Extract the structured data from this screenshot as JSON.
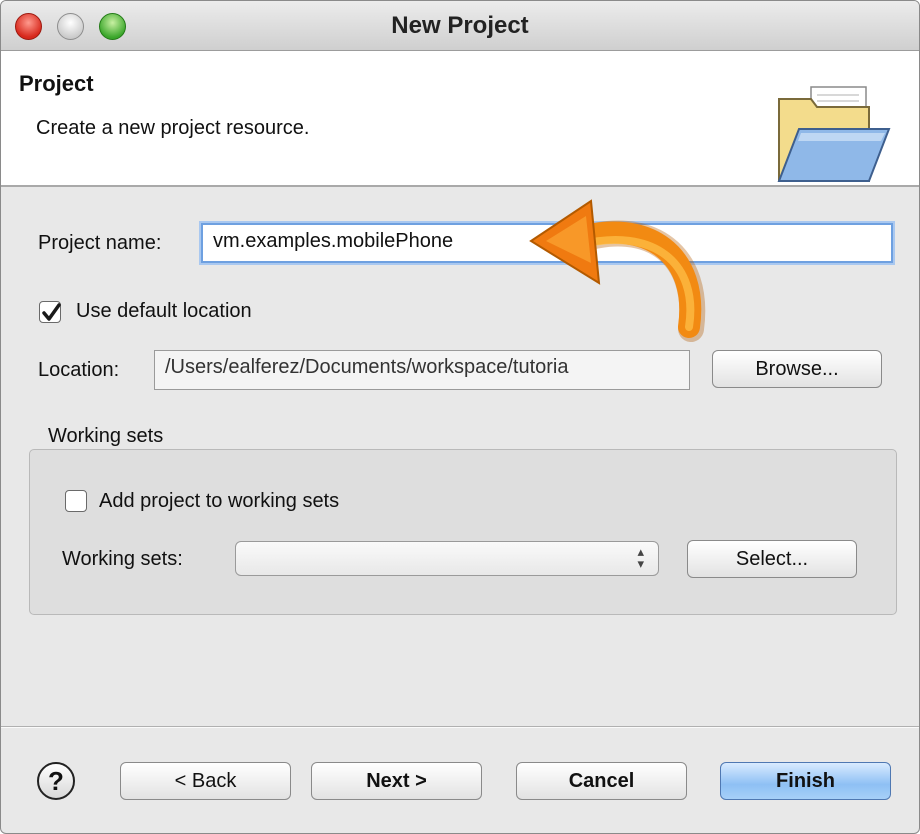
{
  "window": {
    "title": "New Project"
  },
  "header": {
    "title": "Project",
    "description": "Create a new project resource.",
    "icon": "folder-icon"
  },
  "form": {
    "project_name_label": "Project name:",
    "project_name_value": "vm.examples.mobilePhone",
    "use_default_location_label": "Use default location",
    "use_default_location_checked": true,
    "location_label": "Location:",
    "location_value": "/Users/ealferez/Documents/workspace/tutoria",
    "browse_label": "Browse..."
  },
  "working_sets": {
    "group_label": "Working sets",
    "add_label": "Add project to working sets",
    "add_checked": false,
    "select_label": "Working sets:",
    "select_value": "",
    "select_button_label": "Select..."
  },
  "footer": {
    "help_label": "?",
    "back_label": "< Back",
    "next_label": "Next >",
    "cancel_label": "Cancel",
    "finish_label": "Finish"
  },
  "annotation": {
    "arrow_color": "#f08c10",
    "points_to": "project-name-input"
  },
  "colors": {
    "focus_ring": "#6ea0e0",
    "primary_button": "#8ec0f4"
  }
}
